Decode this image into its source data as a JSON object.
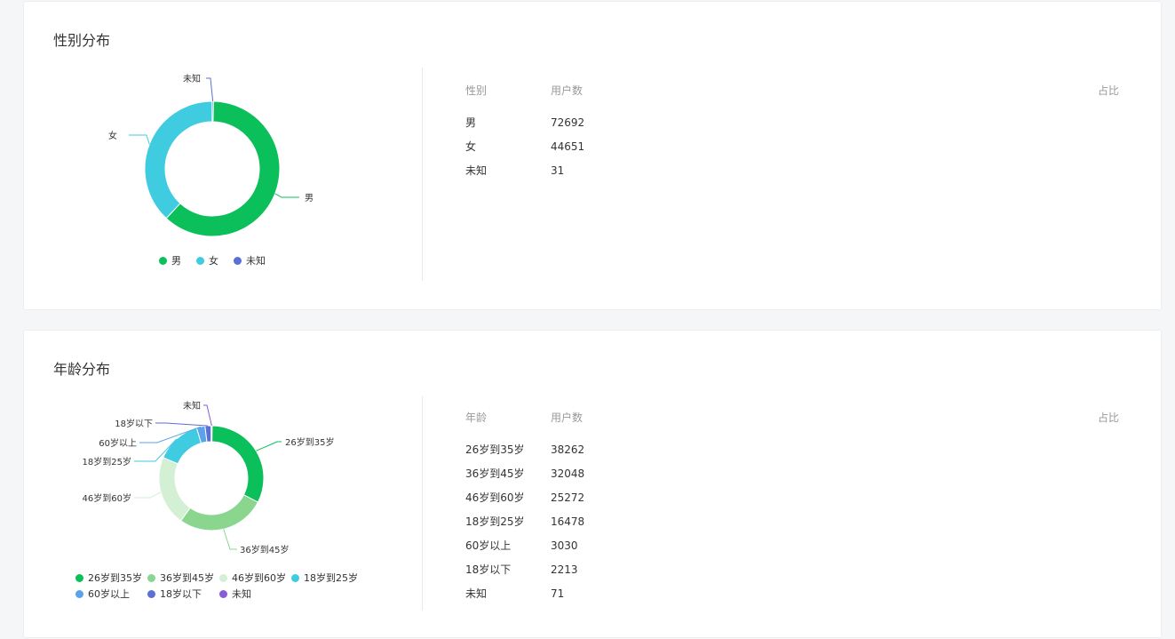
{
  "gender_section": {
    "title": "性别分布",
    "table": {
      "headers": [
        "性别",
        "用户数",
        "占比"
      ],
      "rows": [
        {
          "label": "男",
          "count": "72692",
          "ratio": ""
        },
        {
          "label": "女",
          "count": "44651",
          "ratio": ""
        },
        {
          "label": "未知",
          "count": "31",
          "ratio": ""
        }
      ]
    },
    "legend": [
      "男",
      "女",
      "未知"
    ],
    "colors": [
      "#0bbf5b",
      "#3fcbe0",
      "#5b6fd6"
    ]
  },
  "age_section": {
    "title": "年龄分布",
    "table": {
      "headers": [
        "年龄",
        "用户数",
        "占比"
      ],
      "rows": [
        {
          "label": "26岁到35岁",
          "count": "38262",
          "ratio": ""
        },
        {
          "label": "36岁到45岁",
          "count": "32048",
          "ratio": ""
        },
        {
          "label": "46岁到60岁",
          "count": "25272",
          "ratio": ""
        },
        {
          "label": "18岁到25岁",
          "count": "16478",
          "ratio": ""
        },
        {
          "label": "60岁以上",
          "count": "3030",
          "ratio": ""
        },
        {
          "label": "18岁以下",
          "count": "2213",
          "ratio": ""
        },
        {
          "label": "未知",
          "count": "71",
          "ratio": ""
        }
      ]
    },
    "legend": [
      "26岁到35岁",
      "36岁到45岁",
      "46岁到60岁",
      "18岁到25岁",
      "60岁以上",
      "18岁以下",
      "未知"
    ],
    "colors": [
      "#0bbf5b",
      "#8ad68f",
      "#d3f0d4",
      "#3fcbe0",
      "#5aa3ea",
      "#5b6fd6",
      "#8a5cd6"
    ]
  },
  "chart_data": [
    {
      "type": "pie",
      "categories": [
        "男",
        "女",
        "未知"
      ],
      "values": [
        72692,
        44651,
        31
      ]
    },
    {
      "type": "pie",
      "categories": [
        "26岁到35岁",
        "36岁到45岁",
        "46岁到60岁",
        "18岁到25岁",
        "60岁以上",
        "18岁以下",
        "未知"
      ],
      "values": [
        38262,
        32048,
        25272,
        16478,
        3030,
        2213,
        71
      ]
    }
  ]
}
